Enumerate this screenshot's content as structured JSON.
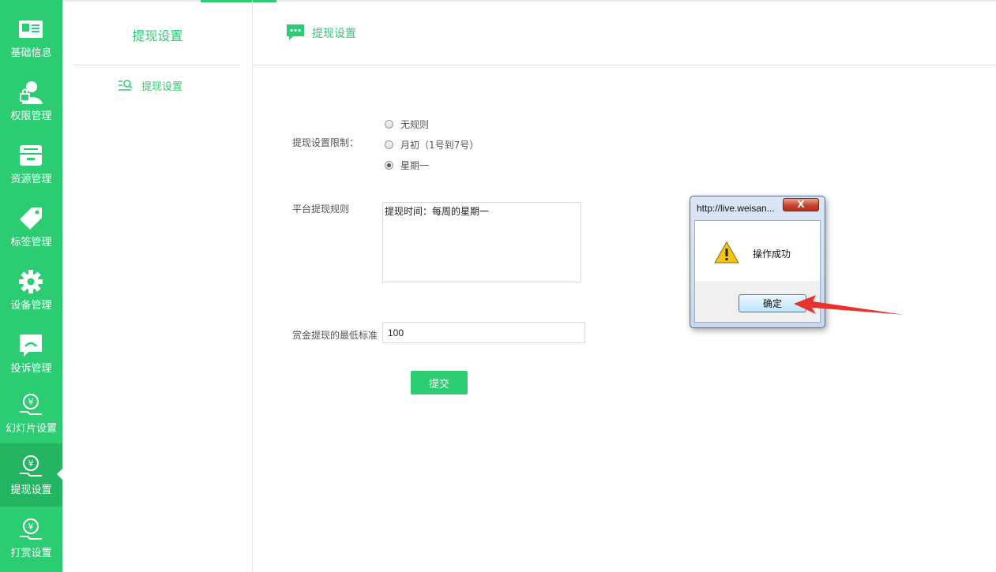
{
  "sidebar": {
    "items": [
      {
        "label": "基础信息",
        "icon": "id-card-icon"
      },
      {
        "label": "权限管理",
        "icon": "user-lock-icon"
      },
      {
        "label": "资源管理",
        "icon": "drawer-icon"
      },
      {
        "label": "标签管理",
        "icon": "tag-icon"
      },
      {
        "label": "设备管理",
        "icon": "gear-icon"
      },
      {
        "label": "投诉管理",
        "icon": "chat-bubble-icon"
      },
      {
        "label": "幻灯片设置",
        "icon": "yuan-hand-icon"
      },
      {
        "label": "提现设置",
        "icon": "yuan-hand-icon",
        "active": true
      },
      {
        "label": "打赏设置",
        "icon": "yuan-hand-icon"
      }
    ],
    "accent_color": "#2bcc72"
  },
  "subnav": {
    "title": "提现设置",
    "items": [
      {
        "label": "提现设置",
        "icon": "search-list-icon"
      }
    ]
  },
  "header": {
    "title": "提现设置",
    "icon": "message-icon"
  },
  "form": {
    "limit_label": "提现设置限制：",
    "limit_options": [
      {
        "label": "无规则",
        "checked": false
      },
      {
        "label": "月初（1号到7号）",
        "checked": false
      },
      {
        "label": "星期一",
        "checked": true
      }
    ],
    "rules_label": "平台提现规则",
    "rules_value": "提现时间：每周的星期一",
    "min_label": "赏金提现的最低标准",
    "min_value": "100",
    "submit_label": "提交"
  },
  "dialog": {
    "title": "http://live.weisan...",
    "close_label": "X",
    "message": "操作成功",
    "ok_label": "确定",
    "icon": "warning-icon"
  }
}
